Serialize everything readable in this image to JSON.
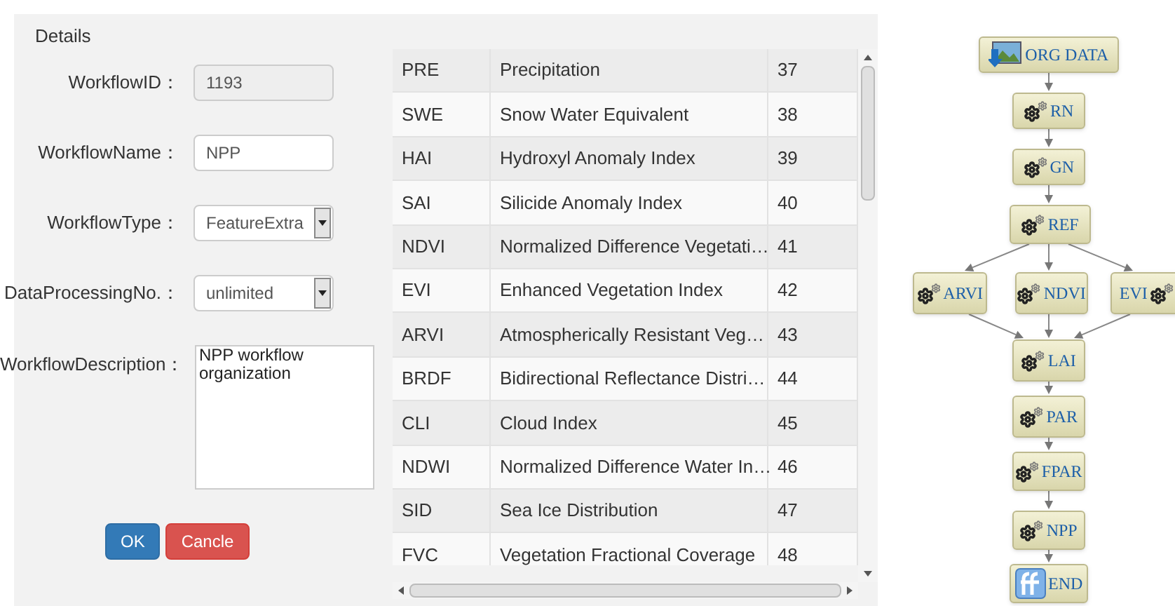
{
  "details": {
    "title": "Details",
    "fields": [
      {
        "kind": "readonly",
        "label": "WorkflowID：",
        "value": "1193",
        "disabled": true
      },
      {
        "kind": "text",
        "label": "WorkflowName：",
        "value": "NPP",
        "disabled": false
      },
      {
        "kind": "select",
        "label": "WorkflowType：",
        "value": "FeatureExtra",
        "disabled": false
      },
      {
        "kind": "select",
        "label": "DataProcessingNo.：",
        "value": "unlimited",
        "disabled": false
      },
      {
        "kind": "textarea",
        "label": "WorkflowDescription：",
        "value": "NPP workflow organization",
        "disabled": false
      }
    ],
    "buttons": [
      {
        "label": "OK",
        "kind": "primary"
      },
      {
        "label": "Cancle",
        "kind": "danger"
      }
    ]
  },
  "table": {
    "rows": [
      [
        "PRE",
        "Precipitation",
        "37"
      ],
      [
        "SWE",
        "Snow Water Equivalent",
        "38"
      ],
      [
        "HAI",
        "Hydroxyl Anomaly Index",
        "39"
      ],
      [
        "SAI",
        "Silicide Anomaly Index",
        "40"
      ],
      [
        "NDVI",
        "Normalized Difference Vegetati…",
        "41"
      ],
      [
        "EVI",
        "Enhanced Vegetation Index",
        "42"
      ],
      [
        "ARVI",
        "Atmospherically Resistant Veg…",
        "43"
      ],
      [
        "BRDF",
        "Bidirectional Reflectance Distri…",
        "44"
      ],
      [
        "CLI",
        "Cloud Index",
        "45"
      ],
      [
        "NDWI",
        "Normalized Difference Water In…",
        "46"
      ],
      [
        "SID",
        "Sea Ice Distribution",
        "47"
      ],
      [
        "FVC",
        "Vegetation Fractional Coverage",
        "48"
      ]
    ]
  },
  "workflow": {
    "nodes": [
      {
        "label": "ORG DATA",
        "kind": "data"
      },
      {
        "label": "RN",
        "kind": "process"
      },
      {
        "label": "GN",
        "kind": "process"
      },
      {
        "label": "REF",
        "kind": "process"
      },
      {
        "label": "ARVI",
        "kind": "process"
      },
      {
        "label": "NDVI",
        "kind": "process"
      },
      {
        "label": "EVI",
        "kind": "process_icon_right"
      },
      {
        "label": "LAI",
        "kind": "process"
      },
      {
        "label": "PAR",
        "kind": "process"
      },
      {
        "label": "FPAR",
        "kind": "process"
      },
      {
        "label": "NPP",
        "kind": "process"
      },
      {
        "label": "END",
        "kind": "end"
      }
    ]
  }
}
